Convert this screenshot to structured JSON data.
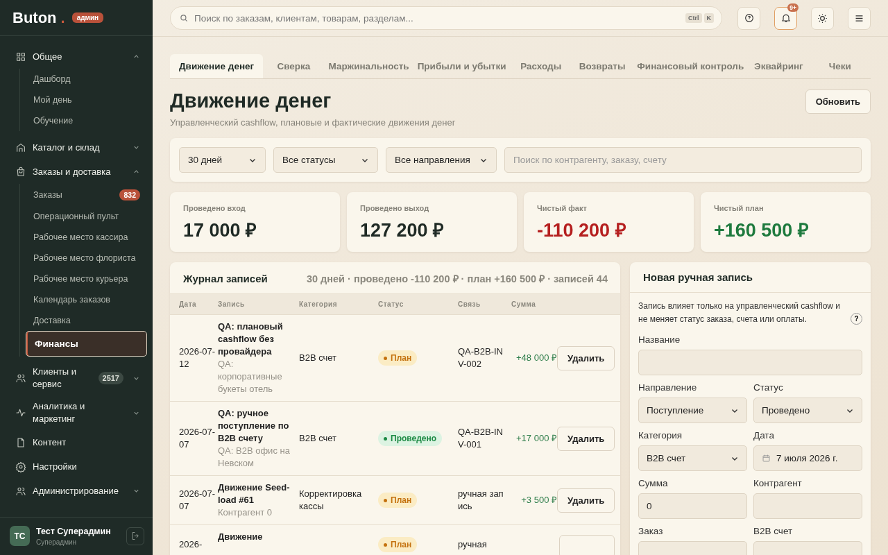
{
  "sidebar": {
    "logo": "Buton",
    "logo_dot": ".",
    "role_badge": "админ",
    "groups": [
      {
        "label": "Общее",
        "expanded": true,
        "children": [
          {
            "label": "Дашборд",
            "selected": false
          },
          {
            "label": "Мой день",
            "selected": false
          },
          {
            "label": "Обучение",
            "selected": false
          }
        ]
      },
      {
        "label": "Каталог и склад",
        "expanded": false
      },
      {
        "label": "Заказы и доставка",
        "expanded": true,
        "children": [
          {
            "label": "Заказы",
            "selected": false,
            "badge": "832"
          },
          {
            "label": "Операционный пульт",
            "selected": false
          },
          {
            "label": "Рабочее место кассира",
            "selected": false
          },
          {
            "label": "Рабочее место флориста",
            "selected": false
          },
          {
            "label": "Рабочее место курьера",
            "selected": false
          },
          {
            "label": "Календарь заказов",
            "selected": false
          },
          {
            "label": "Доставка",
            "selected": false
          },
          {
            "label": "Финансы",
            "selected": true
          }
        ]
      },
      {
        "label": "Клиенты и сервис",
        "expanded": false,
        "badge": "2517"
      },
      {
        "label": "Аналитика и маркетинг",
        "expanded": false
      },
      {
        "label": "Контент"
      },
      {
        "label": "Настройки"
      },
      {
        "label": "Администрирование",
        "expanded": false
      }
    ],
    "user": {
      "initials": "ТС",
      "name": "Тест Суперадмин",
      "role": "Суперадмин"
    }
  },
  "header": {
    "search_placeholder": "Поиск по заказам, клиентам, товарам, разделам...",
    "shortcut": [
      "Ctrl",
      "K"
    ],
    "notifications_badge": "9+"
  },
  "tabs": [
    {
      "label": "Движение денег",
      "selected": true
    },
    {
      "label": "Сверка",
      "selected": false
    },
    {
      "label": "Маржинальность",
      "selected": false
    },
    {
      "label": "Прибыли и убытки",
      "selected": false
    },
    {
      "label": "Расходы",
      "selected": false
    },
    {
      "label": "Возвраты",
      "selected": false
    },
    {
      "label": "Финансовый контроль",
      "selected": false
    },
    {
      "label": "Эквайринг",
      "selected": false
    },
    {
      "label": "Чеки",
      "selected": false
    }
  ],
  "page": {
    "title": "Движение денег",
    "subtitle": "Управленческий cashflow, плановые и фактические движения денег",
    "refresh_button": "Обновить"
  },
  "filters": {
    "selects": [
      "30 дней",
      "Все статусы",
      "Все направления"
    ],
    "search_placeholder": "Поиск по контрагенту, заказу, счету"
  },
  "kpis": [
    {
      "label": "Проведено вход",
      "value": "17 000 ₽",
      "color": "#1f2a25"
    },
    {
      "label": "Проведено выход",
      "value": "127 200 ₽",
      "color": "#1f2a25"
    },
    {
      "label": "Чистый факт",
      "value": "-110 200 ₽",
      "color": "#b51f1f"
    },
    {
      "label": "Чистый план",
      "value": "+160 500 ₽",
      "color": "#1e7a3e"
    }
  ],
  "journal": {
    "title": "Журнал записей",
    "summary": "30 дней · проведено -110 200 ₽ · план +160 500 ₽ · записей 44",
    "columns": [
      "Дата",
      "Запись",
      "Категория",
      "Статус",
      "Связь",
      "Сумма"
    ],
    "rows": [
      {
        "date": "2026-07-12",
        "title": "QA: плановый cashflow без провайдера",
        "note": "QA: корпоративные букеты отель",
        "category": "B2B счет",
        "status": {
          "label": "План",
          "kind": "plan"
        },
        "link": "QA-B2B-INV-002",
        "amount": "+48 000 ₽",
        "action": "Удалить"
      },
      {
        "date": "2026-07-07",
        "title": "QA: ручное поступление по B2B счету",
        "note": "QA: B2B офис на Невском",
        "category": "B2B счет",
        "status": {
          "label": "Проведено",
          "kind": "posted"
        },
        "link": "QA-B2B-INV-001",
        "amount": "+17 000 ₽",
        "action": "Удалить"
      },
      {
        "date": "2026-07-07",
        "title": "Движение Seed-load #61",
        "note": "Контрагент 0",
        "category": "Корректировка кассы",
        "status": {
          "label": "План",
          "kind": "plan"
        },
        "link": "ручная запись",
        "amount": "+3 500 ₽",
        "action": "Удалить"
      },
      {
        "date": "2026-",
        "title": "Движение",
        "status": {
          "label": "План",
          "kind": "plan"
        },
        "link": "ручная"
      }
    ]
  },
  "form": {
    "title": "Новая ручная запись",
    "note": "Запись влияет только на управленческий cashflow и не меняет статус заказа, счета или оплаты.",
    "help_icon": "?",
    "fields": [
      {
        "label": "Название",
        "kind": "text"
      },
      {
        "label": "Направление",
        "kind": "select",
        "value": "Поступление"
      },
      {
        "label": "Статус",
        "kind": "select",
        "value": "Проведено"
      },
      {
        "label": "Категория",
        "kind": "select",
        "value": "B2B счет"
      },
      {
        "label": "Дата",
        "kind": "date",
        "value": "7 июля 2026 г."
      },
      {
        "label": "Сумма",
        "kind": "text",
        "value": "0"
      },
      {
        "label": "Контрагент",
        "kind": "text"
      },
      {
        "label": "Заказ",
        "kind": "text"
      },
      {
        "label": "B2B счет",
        "kind": "text"
      }
    ]
  }
}
